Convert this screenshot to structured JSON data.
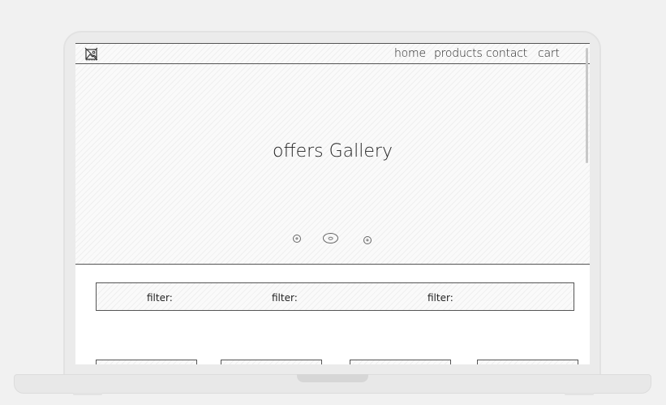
{
  "nav": {
    "links": [
      "home",
      "products",
      "contact",
      "cart"
    ],
    "logo_icon": "image-placeholder-icon"
  },
  "hero": {
    "title": "offers Gallery",
    "carousel_dots": 3,
    "active_dot": 2
  },
  "filters": {
    "labels": [
      "filter:",
      "filter:",
      "filter:"
    ]
  },
  "products": {
    "card_count": 4
  },
  "colors": {
    "outline": "#555555",
    "frame": "#ebebeb"
  }
}
